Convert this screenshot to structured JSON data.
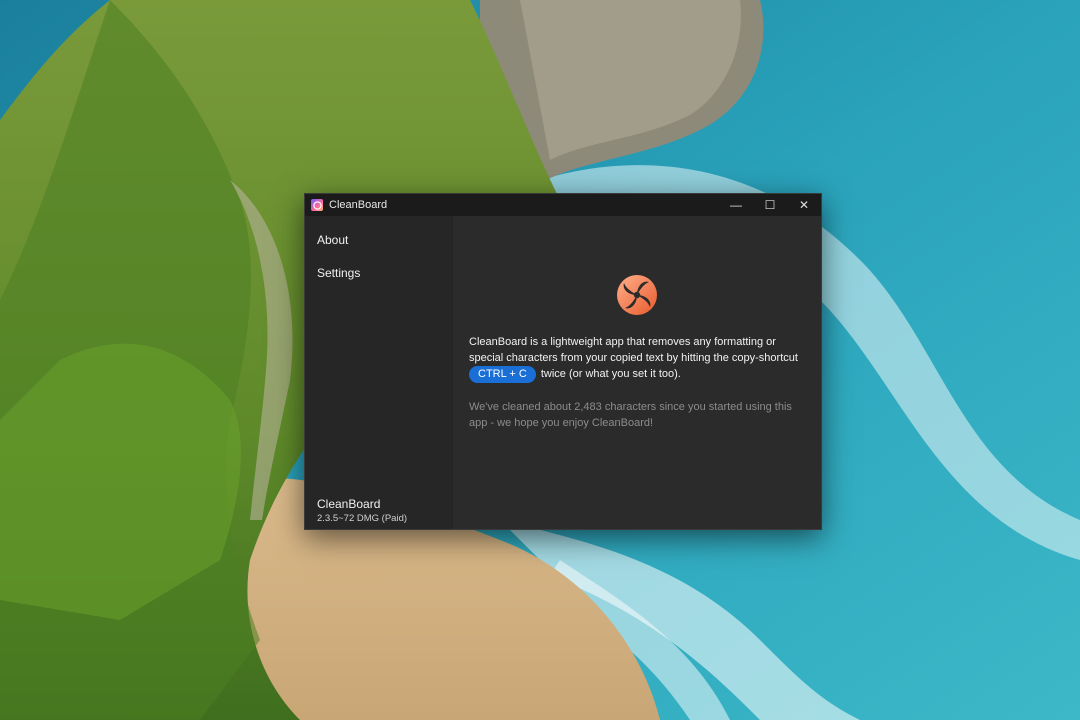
{
  "window": {
    "title": "CleanBoard",
    "controls": {
      "minimize": "—",
      "maximize": "☐",
      "close": "✕"
    }
  },
  "sidebar": {
    "items": [
      {
        "label": "About"
      },
      {
        "label": "Settings"
      }
    ],
    "footer": {
      "app_name": "CleanBoard",
      "version": "2.3.5~72 DMG (Paid)"
    }
  },
  "main": {
    "description_before": "CleanBoard is a lightweight app that removes any formatting or special characters from your copied text by hitting the copy-shortcut",
    "shortcut": "CTRL + C",
    "description_after": "twice (or what you set it too).",
    "stats": "We've cleaned about 2,483 characters since you started using this app - we hope you enjoy CleanBoard!"
  },
  "colors": {
    "accent": "#1a6fd6",
    "logo_orange": "#f2744a",
    "window_bg": "#2b2b2b",
    "sidebar_bg": "#262626"
  },
  "icons": {
    "app": "swirl-logo-icon",
    "minimize": "minimize-icon",
    "maximize": "maximize-icon",
    "close": "close-icon"
  }
}
